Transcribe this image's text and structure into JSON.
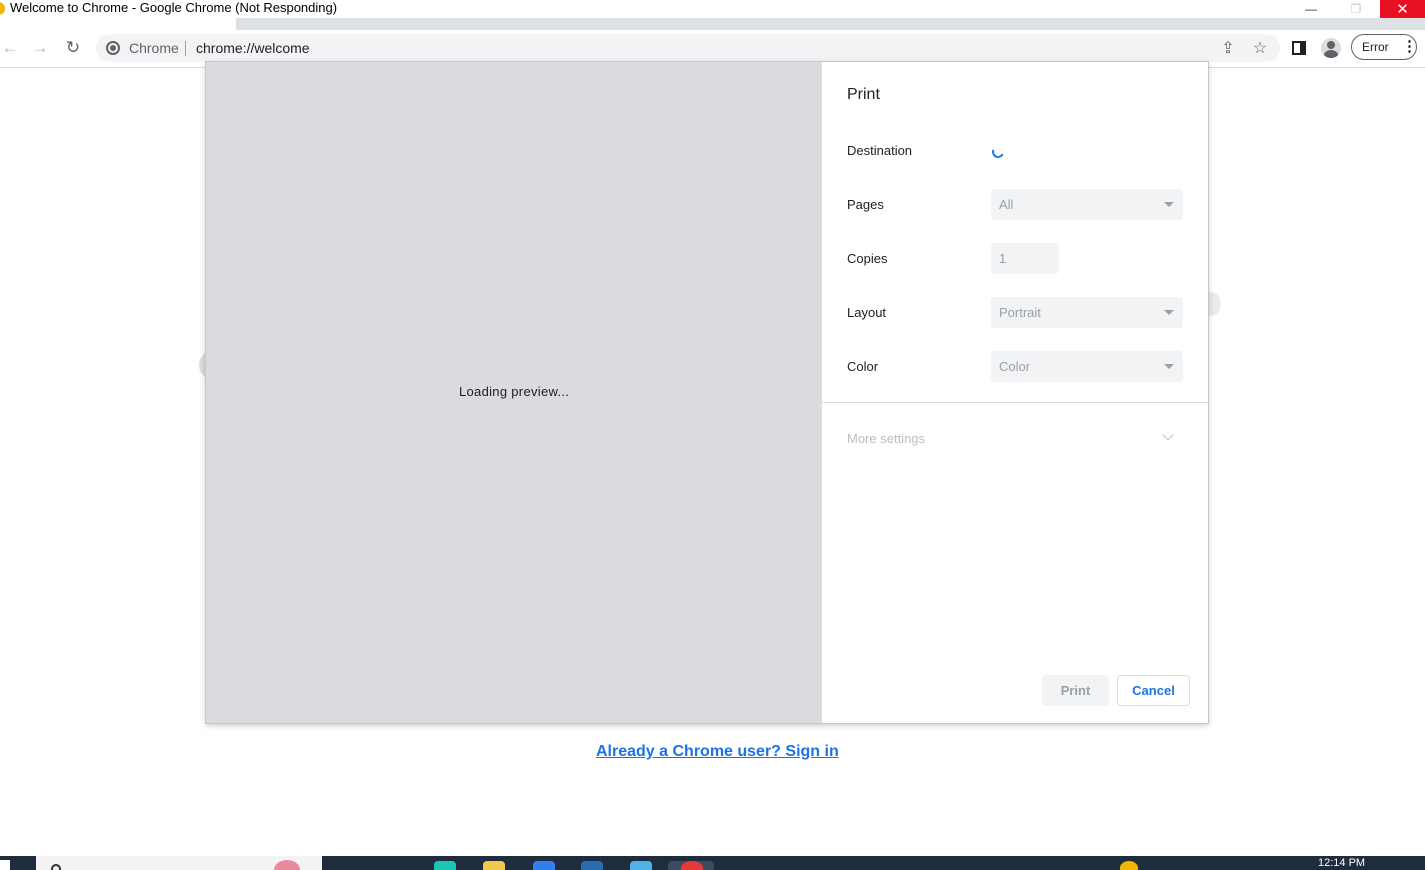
{
  "window": {
    "title": "Welcome to Chrome - Google Chrome (Not Responding)",
    "minimize_glyph": "—",
    "maximize_glyph": "❐",
    "close_glyph": "✕"
  },
  "toolbar": {
    "back_glyph": "←",
    "forward_glyph": "→",
    "reload_glyph": "↻",
    "site_chip_label": "Chrome",
    "url": "chrome://welcome",
    "share_glyph": "⇪",
    "star_glyph": "☆",
    "profile_status": "Error",
    "menu_glyph": "⋮"
  },
  "page": {
    "signin_link": "Already a Chrome user? Sign in"
  },
  "print_dialog": {
    "preview_status": "Loading preview...",
    "title": "Print",
    "destination_label": "Destination",
    "pages_label": "Pages",
    "pages_value": "All",
    "copies_label": "Copies",
    "copies_value": "1",
    "layout_label": "Layout",
    "layout_value": "Portrait",
    "color_label": "Color",
    "color_value": "Color",
    "more_settings_label": "More settings",
    "print_button": "Print",
    "cancel_button": "Cancel"
  },
  "taskbar": {
    "time": "12:14 PM"
  },
  "colors": {
    "accent": "#1a73e8",
    "close_red": "#e81123",
    "preview_bg": "#dadbdf",
    "taskbar_bg": "#1f2c3d"
  }
}
